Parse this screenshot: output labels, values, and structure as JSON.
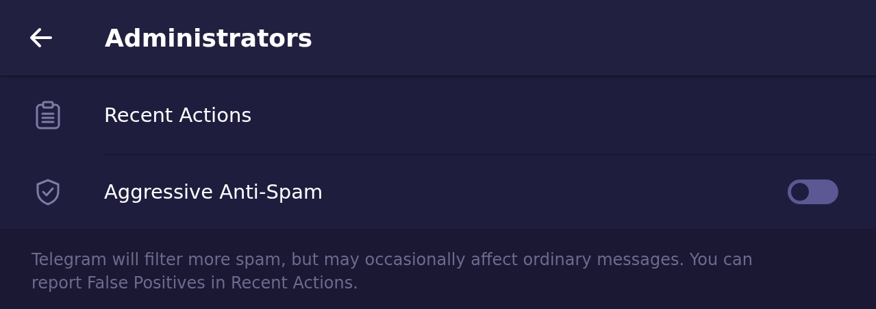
{
  "header": {
    "title": "Administrators"
  },
  "items": [
    {
      "kind": "link",
      "label": "Recent Actions"
    },
    {
      "kind": "toggle",
      "label": "Aggressive Anti-Spam",
      "on": false
    }
  ],
  "footer_note": "Telegram will filter more spam, but may occasionally affect ordinary messages. You can report False Positives in Recent Actions."
}
